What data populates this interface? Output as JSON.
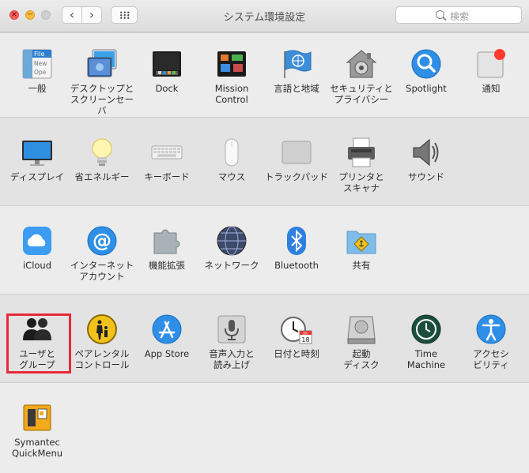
{
  "window": {
    "title": "システム環境設定",
    "search_placeholder": "検索",
    "nav_back": "‹",
    "nav_forward": "›",
    "close_glyph": "×",
    "min_glyph": "−"
  },
  "panes": [
    {
      "label": "一般",
      "icon": "general-file-icon"
    },
    {
      "label": "デスクトップと\nスクリーンセーバ",
      "icon": "desktop-screensaver-icon"
    },
    {
      "label": "Dock",
      "icon": "dock-icon"
    },
    {
      "label": "Mission\nControl",
      "icon": "mission-control-icon"
    },
    {
      "label": "言語と地域",
      "icon": "language-flag-icon"
    },
    {
      "label": "セキュリティと\nプライバシー",
      "icon": "security-house-icon"
    },
    {
      "label": "Spotlight",
      "icon": "spotlight-magnifier-icon"
    },
    {
      "label": "通知",
      "icon": "notifications-icon"
    },
    {
      "label": "ディスプレイ",
      "icon": "display-monitor-icon"
    },
    {
      "label": "省エネルギー",
      "icon": "energy-bulb-icon"
    },
    {
      "label": "キーボード",
      "icon": "keyboard-icon"
    },
    {
      "label": "マウス",
      "icon": "mouse-icon"
    },
    {
      "label": "トラックパッド",
      "icon": "trackpad-icon"
    },
    {
      "label": "プリンタと\nスキャナ",
      "icon": "printer-icon"
    },
    {
      "label": "サウンド",
      "icon": "sound-speaker-icon"
    },
    {
      "label": "iCloud",
      "icon": "icloud-icon"
    },
    {
      "label": "インターネット\nアカウント",
      "icon": "internet-accounts-at-icon"
    },
    {
      "label": "機能拡張",
      "icon": "extensions-puzzle-icon"
    },
    {
      "label": "ネットワーク",
      "icon": "network-globe-icon"
    },
    {
      "label": "Bluetooth",
      "icon": "bluetooth-icon"
    },
    {
      "label": "共有",
      "icon": "sharing-folder-icon"
    },
    {
      "label": "ユーザと\nグループ",
      "icon": "users-groups-icon"
    },
    {
      "label": "ペアレンタル\nコントロール",
      "icon": "parental-controls-icon"
    },
    {
      "label": "App Store",
      "icon": "app-store-icon"
    },
    {
      "label": "音声入力と\n読み上げ",
      "icon": "dictation-microphone-icon"
    },
    {
      "label": "日付と時刻",
      "icon": "date-time-clock-icon"
    },
    {
      "label": "起動\nディスク",
      "icon": "startup-disk-icon"
    },
    {
      "label": "Time\nMachine",
      "icon": "time-machine-icon"
    },
    {
      "label": "アクセシ\nビリティ",
      "icon": "accessibility-icon"
    },
    {
      "label": "Symantec\nQuickMenu",
      "icon": "symantec-quickmenu-icon"
    }
  ],
  "general_icon_text": {
    "line1": "File",
    "line2": "New",
    "line3": "Ope"
  },
  "calendar_icon_text": {
    "month": "JUL",
    "day": "18"
  },
  "colors": {
    "highlight": "#e8293a",
    "notification_badge": "#ff3b30",
    "accent": "#1b8ef0"
  }
}
